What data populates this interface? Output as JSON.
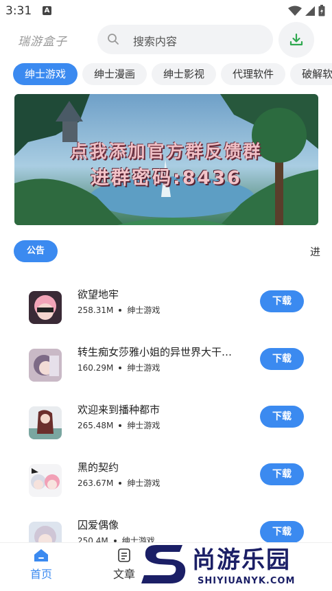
{
  "status_bar": {
    "time": "3:31",
    "notif": "A"
  },
  "header": {
    "logo": "瑞游盒子",
    "search_placeholder": "搜索内容"
  },
  "tabs": [
    "绅士游戏",
    "绅士漫画",
    "绅士影视",
    "代理软件",
    "破解软"
  ],
  "banner": {
    "line1": "点我添加官方群反馈群",
    "line2": "进群密码:8436"
  },
  "notice": {
    "badge": "公告",
    "text": "进"
  },
  "apps": [
    {
      "name": "欲望地牢",
      "size": "258.31M",
      "category": "绅士游戏",
      "button": "下载"
    },
    {
      "name": "转生痴女莎雅小姐的异世界大干…",
      "size": "160.29M",
      "category": "绅士游戏",
      "button": "下载"
    },
    {
      "name": "欢迎来到播种都市",
      "size": "265.48M",
      "category": "绅士游戏",
      "button": "下载"
    },
    {
      "name": "黑的契约",
      "size": "263.67M",
      "category": "绅士游戏",
      "button": "下载"
    },
    {
      "name": "囚爱偶像",
      "size": "250.4M",
      "category": "绅士游戏",
      "button": "下载"
    }
  ],
  "bottom_nav": {
    "home": "首页",
    "article": "文章"
  },
  "watermark": {
    "cn": "尚游乐园",
    "en": "SHIYIUANYK.COM"
  },
  "colors": {
    "accent": "#3b8af0",
    "watermark": "#1b1f66"
  }
}
